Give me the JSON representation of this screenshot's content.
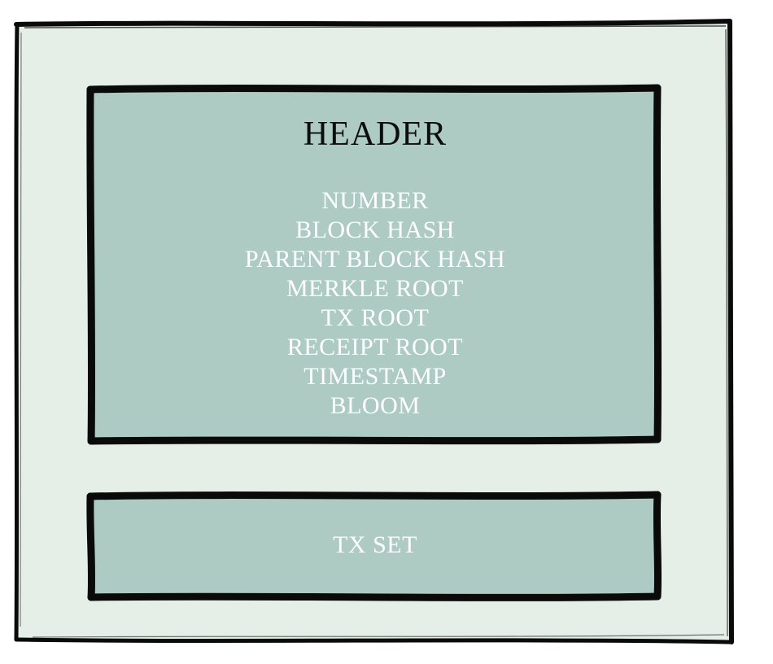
{
  "colors": {
    "outer_fill": "#e6efe7",
    "box_fill": "#adcbc3",
    "stroke": "#0a0a0a",
    "title_text": "#0d0d0d",
    "field_text": "#ffffff"
  },
  "header_box": {
    "title": "HEADER",
    "fields": [
      "NUMBER",
      "BLOCK HASH",
      "PARENT BLOCK HASH",
      "MERKLE ROOT",
      "TX ROOT",
      "RECEIPT ROOT",
      "TIMESTAMP",
      "BLOOM"
    ]
  },
  "txset_box": {
    "label": "TX SET"
  }
}
